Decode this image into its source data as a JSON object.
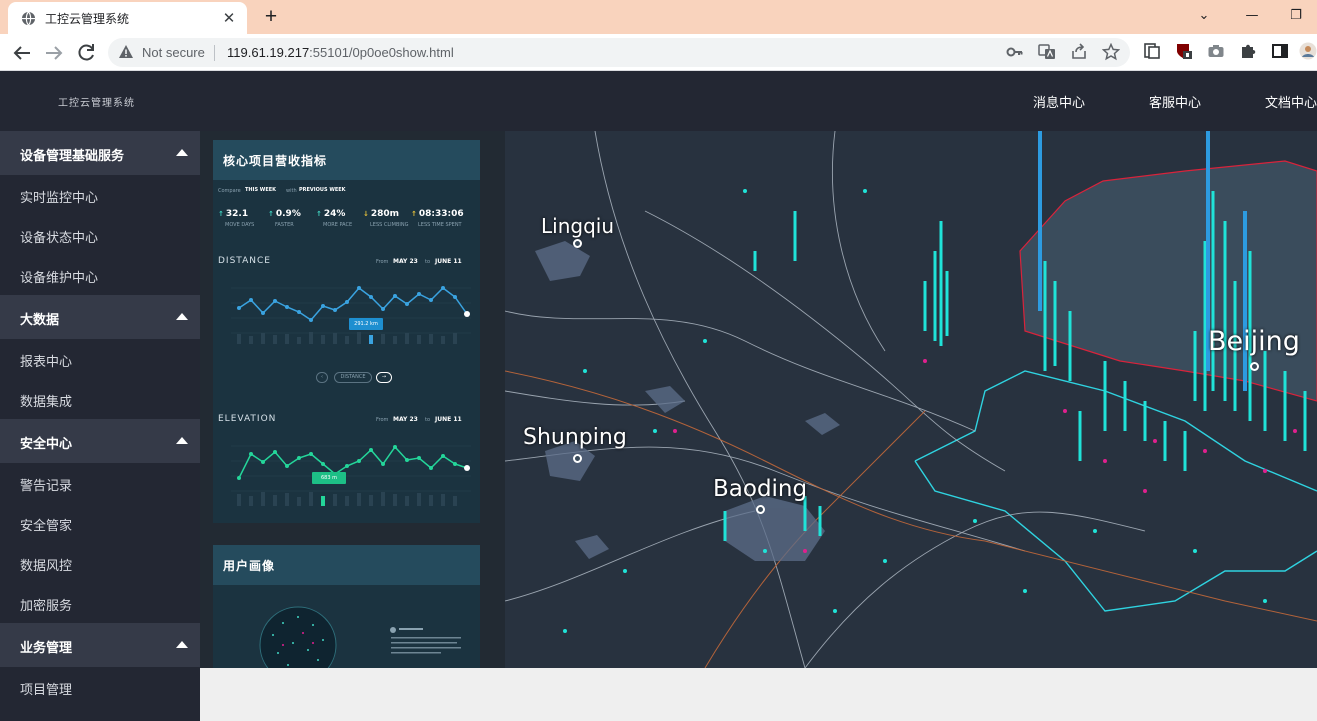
{
  "browser": {
    "tab_title": "工控云管理系统",
    "close_glyph": "✕",
    "new_tab_glyph": "+",
    "security_text": "Not secure",
    "url_host": "119.61.19.217",
    "url_rest": ":55101/0p0oe0show.html",
    "window_minimize_glyph": "—",
    "window_collapse_glyph": "⌄",
    "window_restore_glyph": "❐"
  },
  "header": {
    "brand": "工控云管理系统",
    "nav": [
      "消息中心",
      "客服中心",
      "文档中心"
    ]
  },
  "sidebar": {
    "groups": [
      {
        "label": "设备管理基础服务",
        "items": [
          "实时监控中心",
          "设备状态中心",
          "设备维护中心"
        ]
      },
      {
        "label": "大数据",
        "items": [
          "报表中心",
          "数据集成"
        ]
      },
      {
        "label": "安全中心",
        "items": [
          "警告记录",
          "安全管家",
          "数据风控",
          "加密服务"
        ]
      },
      {
        "label": "业务管理",
        "items": [
          "项目管理"
        ]
      }
    ]
  },
  "dashboard": {
    "card1": {
      "title": "核心项目营收指标",
      "compare": "Compare",
      "this_week": "THIS WEEK",
      "with": "with",
      "previous_week": "PREVIOUS WEEK",
      "stats": [
        {
          "arrow": "↑",
          "value": "32.1",
          "label": "MOVE DAYS"
        },
        {
          "arrow": "↑",
          "value": "0.9%",
          "label": "FASTER"
        },
        {
          "arrow": "↑",
          "value": "24%",
          "label": "MORE PACE"
        },
        {
          "arrow": "↓",
          "value": "280m",
          "label": "LESS CLIMBING"
        },
        {
          "arrow": "↑",
          "value": "08:33:06",
          "label": "LESS TIME SPENT"
        }
      ],
      "distance_label": "DISTANCE",
      "distance_from": "From",
      "distance_from_date": "MAY 23",
      "distance_to": "to",
      "distance_to_date": "JUNE 11",
      "distance_tip": "291.2 km",
      "distance_pill": "DISTANCE",
      "elevation_label": "ELEVATION",
      "elevation_from": "From",
      "elevation_from_date": "MAY 23",
      "elevation_to": "to",
      "elevation_to_date": "JUNE 11",
      "elevation_tip": "683 m"
    },
    "card2": {
      "title": "用户画像"
    },
    "map": {
      "cities": [
        "Lingqiu",
        "Shunping",
        "Baoding",
        "Beijing"
      ],
      "accent_cyan": "#20e3d8",
      "accent_magenta": "#e0208f",
      "border_red": "#d9233b"
    }
  }
}
